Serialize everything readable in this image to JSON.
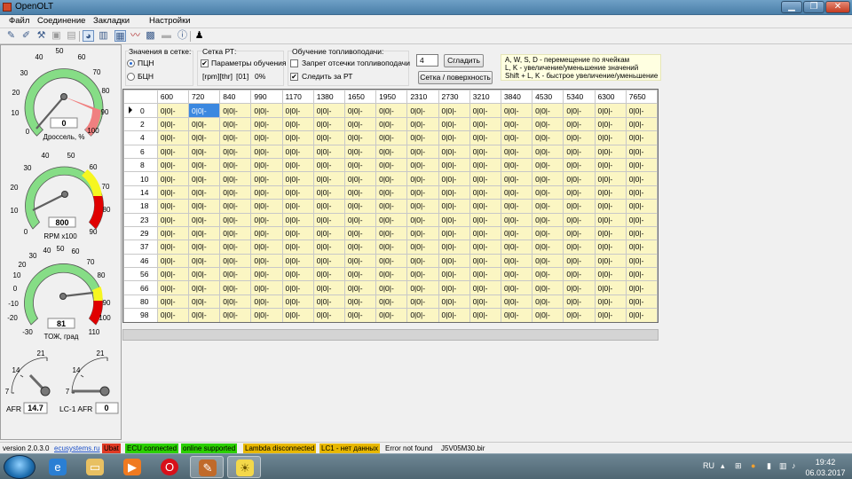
{
  "window": {
    "title": "OpenOLT",
    "minimize": "▁",
    "maximize": "❐",
    "close": "✕"
  },
  "menu": [
    "Файл",
    "Соединение",
    "Закладки",
    "Настройки"
  ],
  "toolbar_icons": [
    "pencil-icon",
    "wrench-icon",
    "tools-icon",
    "chip-icon",
    "disk-icon",
    "gauge-icon",
    "table-icon",
    "grid-icon",
    "chart-icon",
    "dashboard-icon",
    "disabled-icon",
    "info-icon",
    "joystick-icon"
  ],
  "gauges": {
    "throttle": {
      "ticks": [
        "0",
        "10",
        "20",
        "30",
        "40",
        "50",
        "60",
        "70",
        "80",
        "90",
        "100"
      ],
      "value": "0",
      "label": "Дроссель, %"
    },
    "rpm": {
      "ticks": [
        "0",
        "10",
        "20",
        "30",
        "40",
        "50",
        "60",
        "70",
        "80",
        "90"
      ],
      "value": "800",
      "label": "RPM x100"
    },
    "coolant": {
      "ticks": [
        "-30",
        "-20",
        "-10",
        "0",
        "10",
        "20",
        "30",
        "40",
        "50",
        "60",
        "70",
        "80",
        "90",
        "100",
        "110"
      ],
      "value": "81",
      "label": "ТОЖ, град"
    },
    "afr": {
      "ticks": [
        "7",
        "14",
        "21"
      ],
      "label": "AFR",
      "value": "14.7"
    },
    "lc1": {
      "ticks": [
        "7",
        "14",
        "21"
      ],
      "label": "LC-1 AFR",
      "value": "0"
    }
  },
  "controls": {
    "grid_values_title": "Значения в сетке:",
    "radio_pcn": "ПЦН",
    "radio_bcn": "БЦН",
    "rt_grid_title": "Сетка РТ:",
    "learn_params": "Параметры обучения",
    "rt_info_1": "[rpm][thr]",
    "rt_info_2": "[01]",
    "rt_info_3": "0%",
    "fuel_learn_title": "Обучение топливоподачи:",
    "cutoff_ban": "Запрет отсечки топливоподачи",
    "follow_rt": "Следить за РТ",
    "smooth_value": "4",
    "smooth_button": "Сгладить",
    "surface_button": "Сетка / поверхность"
  },
  "hints": [
    "A, W, S, D - перемещение по ячейкам",
    "L, K - увеличение/уменьшение значений",
    "Shift + L, K - быстрое увеличение/уменьшение"
  ],
  "grid": {
    "columns": [
      "600",
      "720",
      "840",
      "990",
      "1170",
      "1380",
      "1650",
      "1950",
      "2310",
      "2730",
      "3210",
      "3840",
      "4530",
      "5340",
      "6300",
      "7650"
    ],
    "rows": [
      "0",
      "2",
      "4",
      "6",
      "8",
      "10",
      "14",
      "18",
      "23",
      "29",
      "37",
      "46",
      "56",
      "66",
      "80",
      "98"
    ],
    "cell_text": "0|0|-"
  },
  "status": {
    "version": "version 2.0.3.0",
    "site": "ecusystems.ru",
    "ubat": "Ubat",
    "ecu": "ECU connected",
    "online": "online supported",
    "lambda": "Lambda disconnected",
    "lc1": "LC1 - нет данных",
    "error": "Error not found",
    "file": "J5V05M30.bir"
  },
  "status_colors": {
    "red": "#e03a24",
    "green": "#2bd000",
    "amber": "#e8b800"
  },
  "taskbar": {
    "lang": "RU",
    "time": "19:42",
    "date": "06.03.2017",
    "apps": [
      "ie-icon",
      "folder-icon",
      "media-icon",
      "opera-icon",
      "openolt-icon",
      "bulb-icon"
    ]
  }
}
